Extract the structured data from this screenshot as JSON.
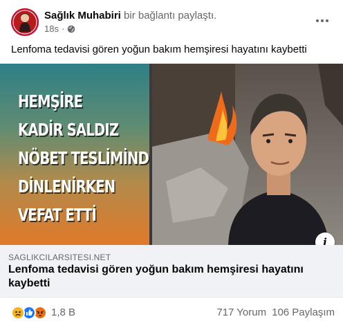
{
  "post": {
    "author": "Sağlık Muhabiri",
    "action": "bir bağlantı paylaştı.",
    "time": "18s",
    "dot": "·",
    "audience_icon": "globe-icon",
    "more_icon": "more-horizontal-icon",
    "caption": "Lenfoma tedavisi gören yoğun bakım hemşiresi hayatını kaybetti"
  },
  "image": {
    "headline_lines": [
      "HEMŞİRE",
      "KADİR SALDIZ",
      "NÖBET TESLİMİNDE",
      "DİNLENİRKEN",
      "VEFAT ETTİ"
    ],
    "info_label": "i"
  },
  "link": {
    "domain": "SAGLIKCILARSITESI.NET",
    "title": "Lenfoma tedavisi gören yoğun bakım hemşiresi hayatını kaybetti"
  },
  "footer": {
    "reaction_icons": [
      "sad-reaction-icon",
      "like-reaction-icon",
      "angry-reaction-icon"
    ],
    "reaction_count": "1,8 B",
    "comments": "717 Yorum",
    "shares": "106 Paylaşım"
  },
  "colors": {
    "accent": "#1877f2",
    "secondary_text": "#65676b",
    "preview_bg": "#f0f2f5",
    "sad": "#f7b125",
    "angry": "#e9710f"
  }
}
